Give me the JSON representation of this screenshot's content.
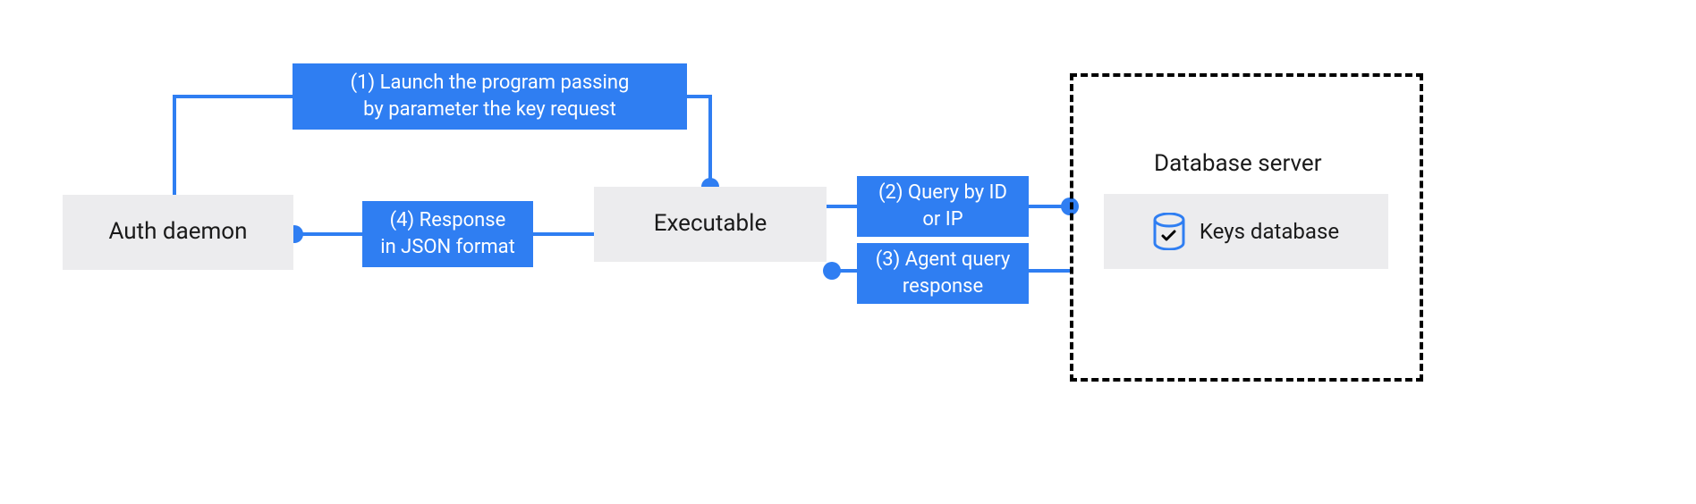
{
  "nodes": {
    "auth_daemon": "Auth daemon",
    "executable": "Executable"
  },
  "steps": {
    "s1": "(1) Launch the program passing\nby parameter the key request",
    "s2": "(2) Query by ID\nor IP",
    "s3": "(3) Agent query\nresponse",
    "s4": "(4) Response\nin JSON format"
  },
  "database": {
    "server_label": "Database server",
    "keys_label": "Keys database"
  },
  "colors": {
    "accent": "#2f7ef2",
    "node_bg": "#ececee"
  }
}
